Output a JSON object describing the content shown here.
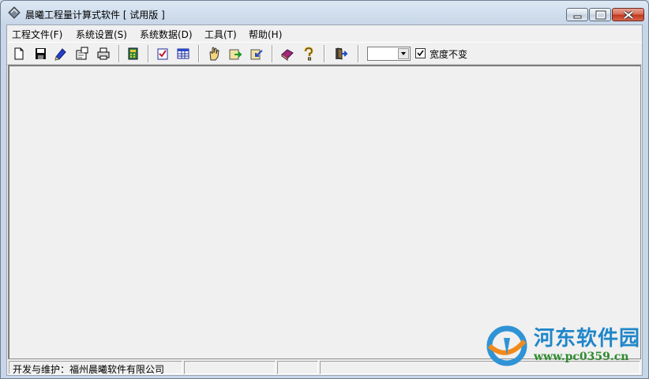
{
  "window": {
    "title": "晨曦工程量计算式软件 [ 试用版 ]"
  },
  "menu": [
    {
      "label": "工程文件(F)"
    },
    {
      "label": "系统设置(S)"
    },
    {
      "label": "系统数据(D)"
    },
    {
      "label": "工具(T)"
    },
    {
      "label": "帮助(H)"
    }
  ],
  "toolbar": {
    "icons": [
      "new-file-icon",
      "save-icon",
      "edit-pen-icon",
      "properties-icon",
      "print-icon",
      "calculator-icon",
      "checklist-icon",
      "table-icon",
      "hand-icon",
      "export-icon",
      "import-icon",
      "book-icon",
      "help-icon",
      "exit-icon"
    ],
    "combo_value": "",
    "checkbox_checked": true,
    "checkbox_label": "宽度不变"
  },
  "statusbar": {
    "developer": "开发与维护：福州晨曦软件有限公司"
  },
  "watermark": {
    "name": "河东软件园",
    "url": "www.pc0359.cn"
  }
}
